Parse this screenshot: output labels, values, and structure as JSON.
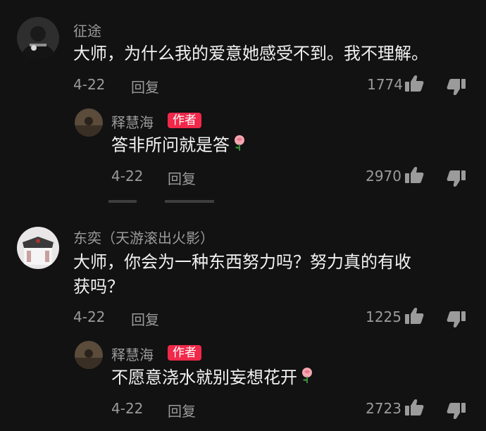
{
  "comments": [
    {
      "username": "征途",
      "text": "大师，为什么我的爱意她感受不到。我不理解。",
      "date": "4-22",
      "reply_label": "回复",
      "likes": "1774",
      "reply": {
        "username": "释慧海",
        "badge": "作者",
        "text": "答非所问就是答",
        "date": "4-22",
        "reply_label": "回复",
        "likes": "2970"
      }
    },
    {
      "username": "东奕（天游滚出火影）",
      "text_line1": "大师，你会为一种东西努力吗？努力真的有收",
      "text_line2": "获吗？",
      "date": "4-22",
      "reply_label": "回复",
      "likes": "1225",
      "reply": {
        "username": "释慧海",
        "badge": "作者",
        "text": "不愿意浇水就别妄想花开",
        "date": "4-22",
        "reply_label": "回复",
        "likes": "2723"
      }
    }
  ],
  "icons": {
    "like": "thumb-up-icon",
    "dislike": "thumb-down-icon",
    "emoji": "rose-emoji"
  },
  "colors": {
    "background": "#121212",
    "badge": "#f0284a",
    "muted": "#9b9b9b",
    "text": "#f2f2f2"
  }
}
